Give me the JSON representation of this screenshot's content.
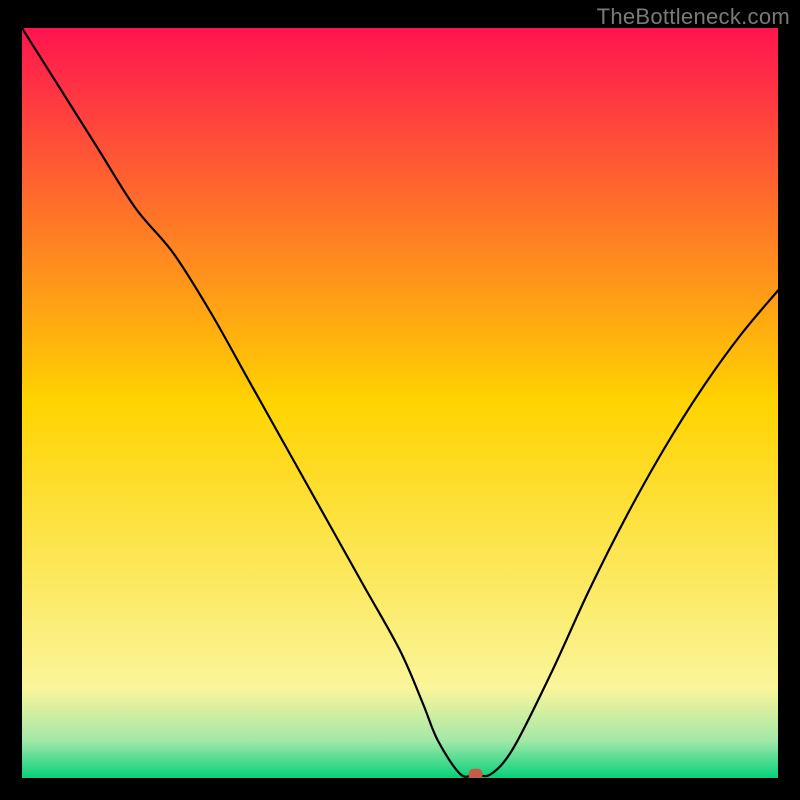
{
  "watermark": "TheBottleneck.com",
  "chart_data": {
    "type": "line",
    "title": "",
    "xlabel": "",
    "ylabel": "",
    "xlim": [
      0,
      100
    ],
    "ylim": [
      0,
      100
    ],
    "grid": false,
    "legend": false,
    "background": {
      "kind": "horizontal-band",
      "top_y": 0,
      "bottom_y": 100,
      "stops": [
        {
          "y": 100,
          "color": "#ff1450"
        },
        {
          "y": 50,
          "color": "#ffd400"
        },
        {
          "y": 12,
          "color": "#faf59a"
        },
        {
          "y": 5,
          "color": "#a2e8a8"
        },
        {
          "y": 0,
          "color": "#06d17a"
        }
      ]
    },
    "series": [
      {
        "name": "bottleneck-curve",
        "color": "#000000",
        "x": [
          0,
          5,
          10,
          15,
          20,
          25,
          30,
          35,
          40,
          45,
          50,
          53,
          55,
          58,
          60,
          62,
          65,
          70,
          75,
          80,
          85,
          90,
          95,
          100
        ],
        "y": [
          100,
          92,
          84,
          76,
          70,
          62,
          53,
          44,
          35,
          26,
          17,
          10,
          5,
          0.5,
          0.5,
          0.5,
          4,
          14,
          25,
          35,
          44,
          52,
          59,
          65
        ]
      }
    ],
    "marker": {
      "name": "optimal-point",
      "x": 60,
      "y": 0.5,
      "color": "#c85a4a",
      "shape": "rounded-rect"
    }
  }
}
